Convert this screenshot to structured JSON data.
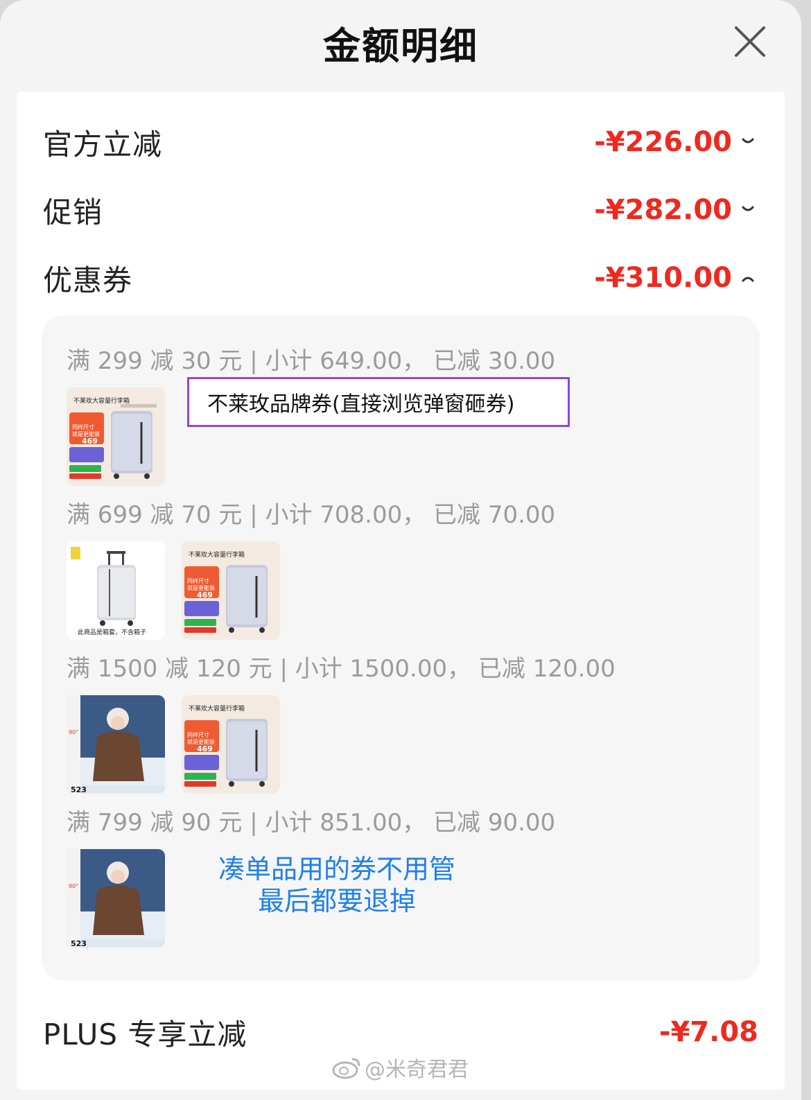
{
  "header": {
    "title": "金额明细",
    "close_icon": "close-icon"
  },
  "rows": [
    {
      "label": "官方立减",
      "value": "-¥226.00",
      "chevron": "chevron-down-icon"
    },
    {
      "label": "促销",
      "value": "-¥282.00",
      "chevron": "chevron-down-icon"
    },
    {
      "label": "优惠券",
      "value": "-¥310.00",
      "chevron": "chevron-up-icon"
    }
  ],
  "coupon_groups": [
    {
      "heading": "满 299 减 30 元 | 小计 649.00， 已减 30.00"
    },
    {
      "heading": "满 699 减 70 元 | 小计 708.00， 已减 70.00"
    },
    {
      "heading": "满 1500 减 120 元 | 小计 1500.00， 已减 120.00"
    },
    {
      "heading": "满 799 减 90 元 | 小计 851.00， 已减 90.00"
    }
  ],
  "products": {
    "luggage": {
      "banner": "不莱玫大容量行李箱",
      "tag1": "同样尺寸",
      "tag2": "就是更能装",
      "price": "469"
    },
    "cover": {
      "caption": "此商品是箱套，不含箱子"
    },
    "jacket": {
      "price": "523",
      "badge": "90°"
    }
  },
  "annotations": {
    "purple_box": "不莱玫品牌券(直接浏览弹窗砸券)",
    "blue_line1": "凑单品用的券不用管",
    "blue_line2": "最后都要退掉"
  },
  "plus": {
    "label": "PLUS 专享立减",
    "value": "-¥7.08"
  },
  "watermark": "@米奇君君",
  "colors": {
    "price_red": "#f0281e",
    "annotation_purple": "#8b46e6",
    "annotation_blue": "#1e7ff0"
  }
}
